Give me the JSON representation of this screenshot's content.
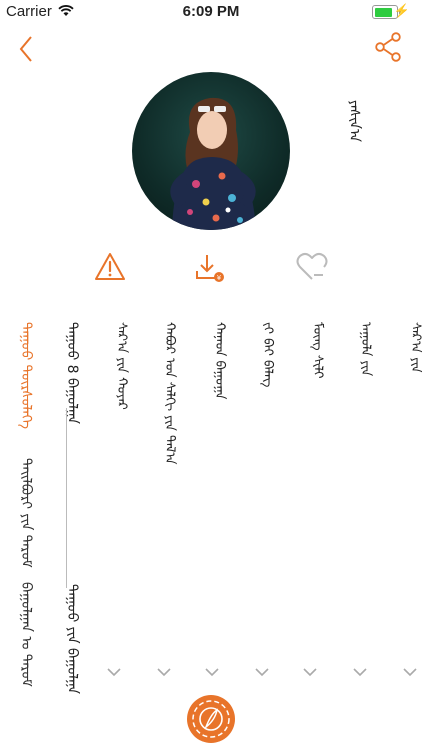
{
  "status_bar": {
    "carrier": "Carrier",
    "time": "6:09 PM",
    "battery_percent": 90
  },
  "song": {
    "title": "ᠶᠠᠰᠢᠨ᠎ᠠ"
  },
  "side_menu": [
    {
      "label": "ᠳᠠᠭᠤᠤ ᠳᠦᠷᠰᠦᠯᠡᠭᠡ",
      "active": true
    },
    {
      "label": "ᠲᠠᠢᠯᠪᠤᠷᠢ ᠶᠢᠨ ᠳᠠᠷᠤᠮ",
      "active": false
    },
    {
      "label": "ᠪᠠᠭᠤᠯᠭᠠᠨ ᠤ ᠳᠠᠷᠤᠮ",
      "active": false
    }
  ],
  "tabs": [
    {
      "label": "ᠳᠠᠭᠤᠤ 8 ᠪᠠᠭᠤᠯᠭᠠ"
    },
    {
      "label": "ᠳᠠᠭᠤᠤ ᠶᠢᠨ ᠪᠠᠭᠤᠯᠭᠠ"
    }
  ],
  "lyrics": [
    "ᠰᠠᠷ᠎ᠠ ᠶᠢᠨ ᠬᠣᠶᠠᠷ",
    "ᠬᠠᠪᠣᠷ ᠤᠨ ᠰᠠᠯᠬᠢ ᠶᠢᠨ ᠲᠠᠯ᠎ᠠ",
    "ᠬᠠᠨᠠᠳ ᠪᠠᠭᠤᠭ᠋ᠠ",
    "ᠵᠢ ᠪᠠᠢ ᠪᠡᠯᠡᠭ᠌",
    "ᠮᠥᠩ ᠰᠢᠯᠢ",
    "ᠠᠭᠤᠯᠠ ᠶᠢᠨ",
    "ᠰᠠᠷ᠎ᠠ ᠶᠢᠨ"
  ],
  "colors": {
    "accent": "#e8742a",
    "text": "#222222",
    "divider": "#bbbbbb",
    "chevron": "#aaaaaa"
  },
  "icons": [
    "back-icon",
    "share-icon",
    "warning-icon",
    "download-icon",
    "heart-icon",
    "chevron-down-icon",
    "app-logo-icon"
  ]
}
